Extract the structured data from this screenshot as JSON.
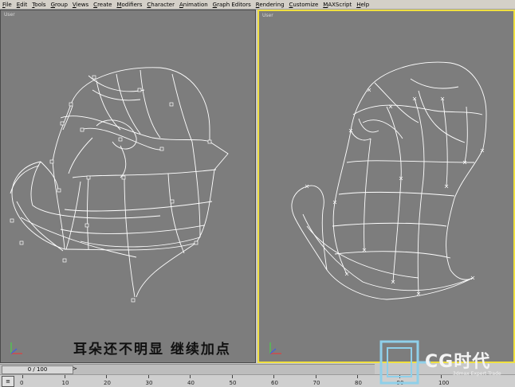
{
  "menu": [
    "File",
    "Edit",
    "Tools",
    "Group",
    "Views",
    "Create",
    "Modifiers",
    "Character",
    "Animation",
    "Graph Editors",
    "Rendering",
    "Customize",
    "MAXScript",
    "Help"
  ],
  "viewports": [
    {
      "label": "User",
      "active": false
    },
    {
      "label": "User",
      "active": true
    }
  ],
  "caption": "耳朵还不明显  继续加点",
  "timeslider": {
    "value": "0 / 100"
  },
  "ruler": {
    "ticks": [
      "0",
      "10",
      "20",
      "30",
      "40",
      "50",
      "60",
      "70",
      "80",
      "90",
      "100"
    ]
  },
  "logo": {
    "text": "CG时代",
    "sub": "3dmax Expert Trade",
    "frame_color": "#8fd0ea"
  },
  "colors": {
    "viewport_bg": "#7d7d7d",
    "active_border": "#f0e040",
    "wire": "#ffffff"
  }
}
